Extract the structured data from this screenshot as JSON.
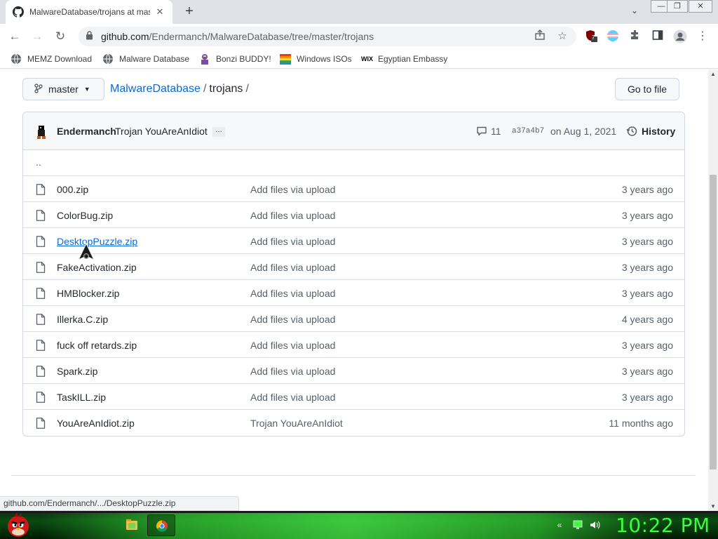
{
  "browser": {
    "tab_title": "MalwareDatabase/trojans at master",
    "close_glyph": "✕",
    "newtab_glyph": "+",
    "tabsearch_glyph": "⌄",
    "window_controls": {
      "minimize": "—",
      "restore": "❐",
      "close": "✕"
    },
    "nav": {
      "back": "←",
      "forward": "→",
      "reload": "↻"
    },
    "url_host": "github.com",
    "url_path": "/Endermanch/MalwareDatabase/tree/master/trojans",
    "extension_badge": "7",
    "bookmarks": [
      {
        "label": "MEMZ Download",
        "icon": "globe-icon"
      },
      {
        "label": "Malware Database",
        "icon": "globe-icon"
      },
      {
        "label": "Bonzi BUDDY!",
        "icon": "bonzi-icon"
      },
      {
        "label": "Windows ISOs",
        "icon": "windows-icon"
      },
      {
        "label": "Egyptian Embassy",
        "icon": "wix-icon"
      }
    ]
  },
  "repo": {
    "branch": "master",
    "breadcrumb_repo": "MalwareDatabase",
    "breadcrumb_sep": "/",
    "breadcrumb_current": "trojans",
    "breadcrumb_trailing": "/",
    "goto_file_label": "Go to file"
  },
  "commit": {
    "author": "Endermanch",
    "message": "Trojan YouAreAnIdiot",
    "ellipsis": "…",
    "comments": "11",
    "sha": "a37a4b7",
    "date": "on Aug 1, 2021",
    "history_label": "History"
  },
  "files": {
    "updir": "..",
    "rows": [
      {
        "name": "000.zip",
        "message": "Add files via upload",
        "age": "3 years ago"
      },
      {
        "name": "ColorBug.zip",
        "message": "Add files via upload",
        "age": "3 years ago"
      },
      {
        "name": "DesktopPuzzle.zip",
        "message": "Add files via upload",
        "age": "3 years ago"
      },
      {
        "name": "FakeActivation.zip",
        "message": "Add files via upload",
        "age": "3 years ago"
      },
      {
        "name": "HMBlocker.zip",
        "message": "Add files via upload",
        "age": "3 years ago"
      },
      {
        "name": "Illerka.C.zip",
        "message": "Add files via upload",
        "age": "4 years ago"
      },
      {
        "name": "fuck off retards.zip",
        "message": "Add files via upload",
        "age": "3 years ago"
      },
      {
        "name": "Spark.zip",
        "message": "Add files via upload",
        "age": "3 years ago"
      },
      {
        "name": "TaskILL.zip",
        "message": "Add files via upload",
        "age": "3 years ago"
      },
      {
        "name": "YouAreAnIdiot.zip",
        "message": "Trojan YouAreAnIdiot",
        "age": "11 months ago"
      }
    ]
  },
  "status_bar": "github.com/Endermanch/.../DesktopPuzzle.zip",
  "taskbar": {
    "clock": "10:22 PM"
  },
  "colors": {
    "link": "#0969da",
    "text": "#24292f",
    "muted": "#57606a",
    "clock": "#3cff3c"
  }
}
